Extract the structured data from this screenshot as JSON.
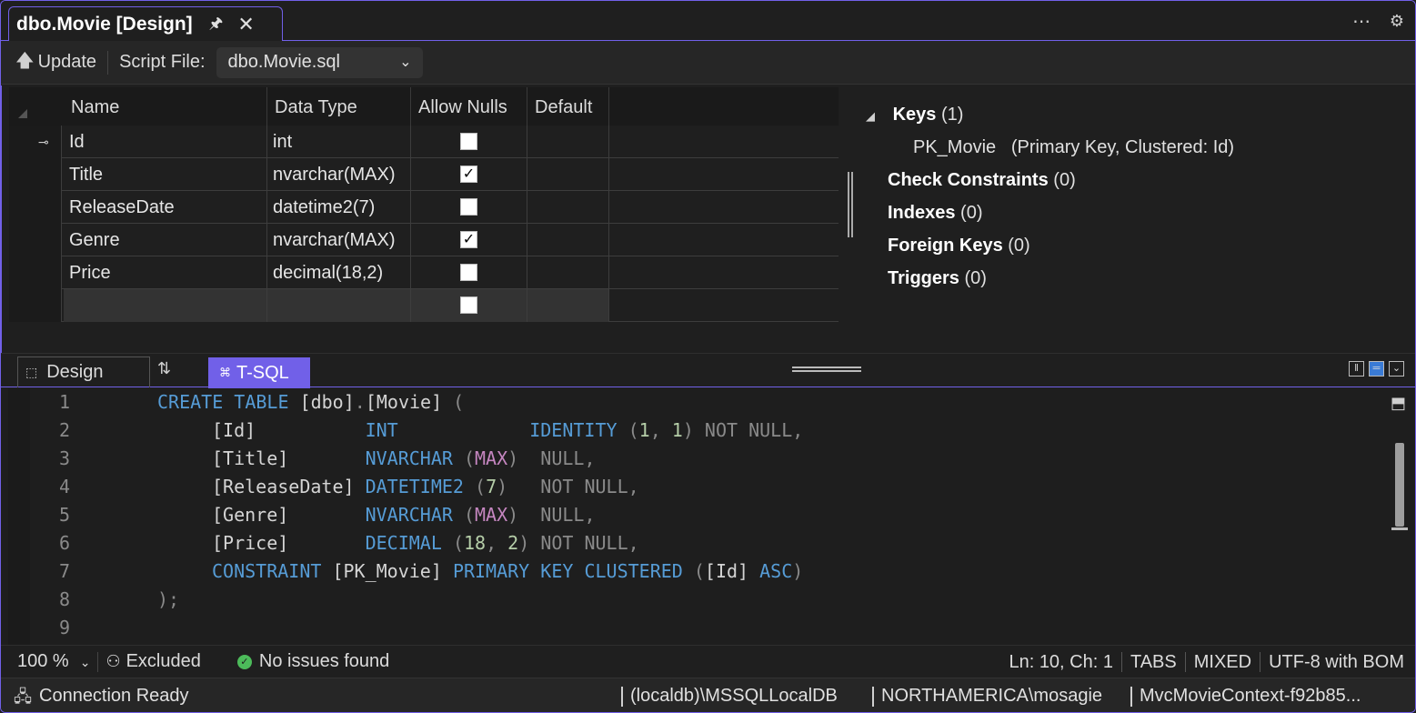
{
  "document_tab": {
    "title": "dbo.Movie [Design]"
  },
  "toolbar": {
    "update_label": "Update",
    "script_file_label": "Script File:",
    "script_file_value": "dbo.Movie.sql"
  },
  "grid": {
    "columns": [
      "Name",
      "Data Type",
      "Allow Nulls",
      "Default"
    ],
    "rows": [
      {
        "name": "Id",
        "type": "int",
        "allow_nulls": false,
        "is_key": true
      },
      {
        "name": "Title",
        "type": "nvarchar(MAX)",
        "allow_nulls": true,
        "is_key": false
      },
      {
        "name": "ReleaseDate",
        "type": "datetime2(7)",
        "allow_nulls": false,
        "is_key": false
      },
      {
        "name": "Genre",
        "type": "nvarchar(MAX)",
        "allow_nulls": true,
        "is_key": false
      },
      {
        "name": "Price",
        "type": "decimal(18,2)",
        "allow_nulls": false,
        "is_key": false
      }
    ]
  },
  "properties": {
    "keys_label": "Keys",
    "keys_count": "(1)",
    "pk_name": "PK_Movie",
    "pk_desc": "(Primary Key, Clustered: Id)",
    "check_label": "Check Constraints",
    "check_count": "(0)",
    "indexes_label": "Indexes",
    "indexes_count": "(0)",
    "fk_label": "Foreign Keys",
    "fk_count": "(0)",
    "triggers_label": "Triggers",
    "triggers_count": "(0)"
  },
  "pane_tabs": {
    "design": "Design",
    "tsql": "T-SQL"
  },
  "editor": {
    "line_numbers": [
      "1",
      "2",
      "3",
      "4",
      "5",
      "6",
      "7",
      "8",
      "9"
    ]
  },
  "editor_status": {
    "zoom": "100 %",
    "excluded": "Excluded",
    "issues": "No issues found",
    "position": "Ln: 10, Ch: 1",
    "indent": "TABS",
    "line_endings": "MIXED",
    "encoding": "UTF-8 with BOM"
  },
  "statusbar": {
    "connection": "Connection Ready",
    "server": "(localdb)\\MSSQLLocalDB",
    "user": "NORTHAMERICA\\mosagie",
    "database": "MvcMovieContext-f92b85..."
  },
  "colors": {
    "accent": "#7160e8",
    "keyword": "#569cd6",
    "function": "#c586c0",
    "success": "#4cbb5a"
  }
}
